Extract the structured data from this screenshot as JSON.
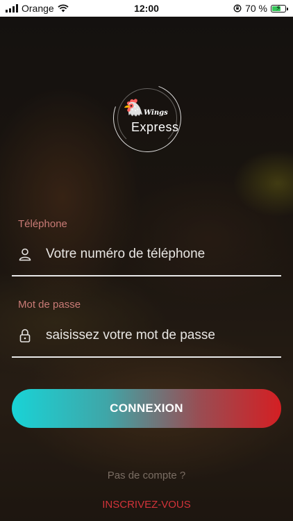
{
  "status_bar": {
    "carrier": "Orange",
    "time": "12:00",
    "battery_percent": "70 %",
    "battery_level": 0.7,
    "icons": [
      "signal-icon",
      "wifi-icon",
      "orientation-lock-icon",
      "battery-charging-icon"
    ]
  },
  "logo": {
    "wings_text": "Wings",
    "express_text": "Express"
  },
  "phone": {
    "label": "Téléphone",
    "placeholder": "Votre numéro de téléphone",
    "icon": "user-icon"
  },
  "password": {
    "label": "Mot de passe",
    "placeholder": "saisissez votre mot de passe",
    "icon": "lock-icon"
  },
  "login_button": {
    "label": "CONNEXION"
  },
  "no_account_text": "Pas de compte ?",
  "register_link": "INSCRIVEZ-VOUS",
  "colors": {
    "label": "#c97b76",
    "gradient_start": "#19d3d6",
    "gradient_end": "#d41f23",
    "register": "#d3333a",
    "battery": "#34c759"
  }
}
